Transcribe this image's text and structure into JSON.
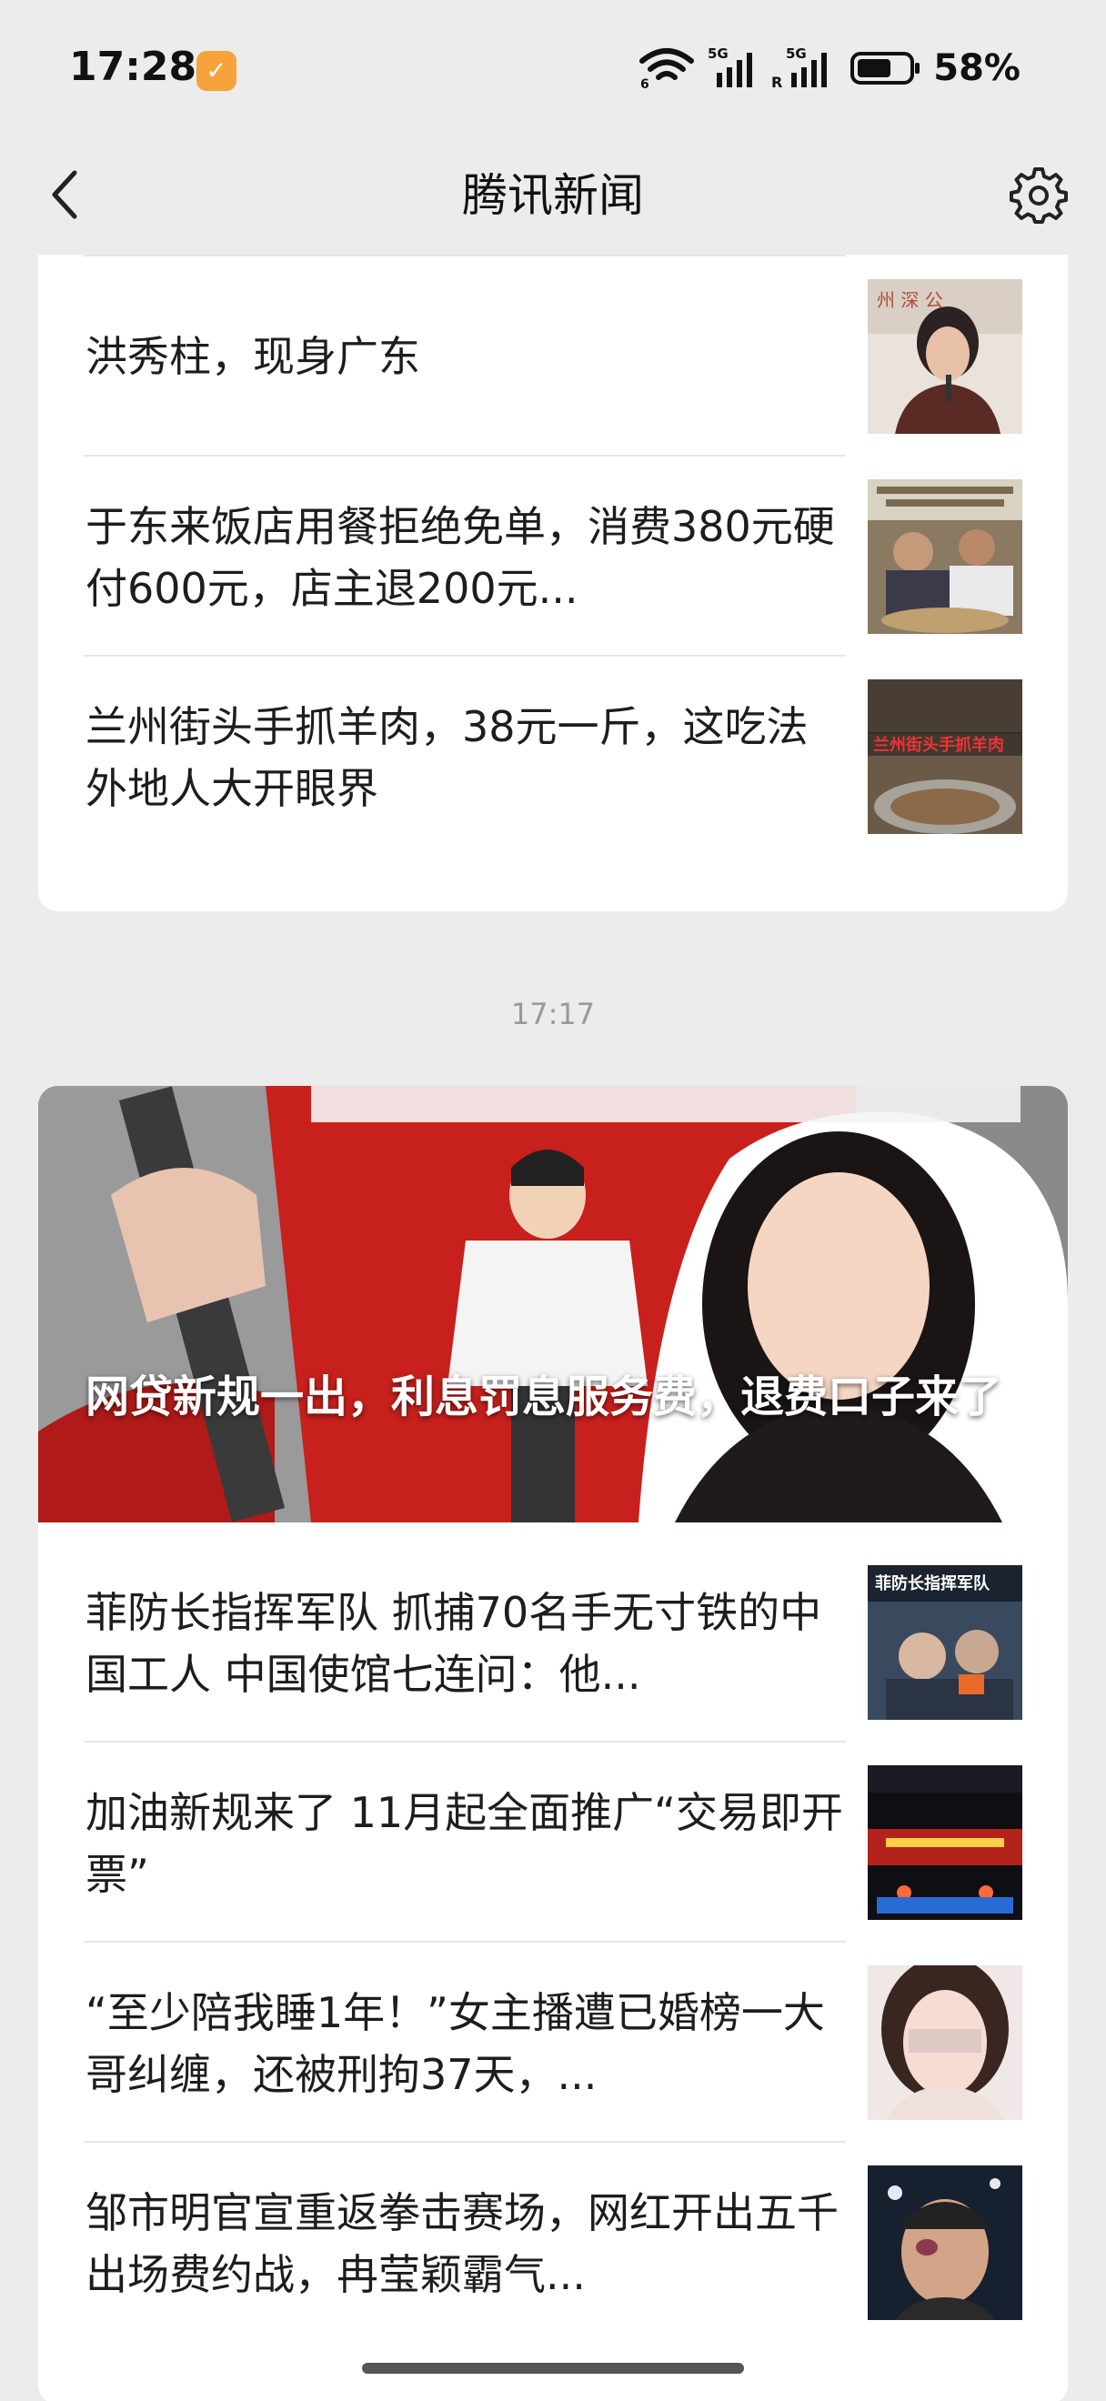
{
  "status_bar": {
    "time": "17:28",
    "battery": "58%",
    "signal1_label": "5G",
    "signal2_label": "5G",
    "wifi_sub": "6",
    "sim2_sub": "R"
  },
  "header": {
    "title": "腾讯新闻"
  },
  "card1": {
    "items": [
      {
        "title": "洪秀柱，现身广东"
      },
      {
        "title": "于东来饭店用餐拒绝免单，消费380元硬付600元，店主退200元..."
      },
      {
        "title": "兰州街头手抓羊肉，38元一斤，这吃法外地人大开眼界"
      }
    ]
  },
  "time_separator": "17:17",
  "card2": {
    "hero": {
      "title": "网贷新规一出，利息罚息服务费，退费口子来了"
    },
    "items": [
      {
        "title": "菲防长指挥军队 抓捕70名手无寸铁的中国工人 中国使馆七连问：他..."
      },
      {
        "title": "加油新规来了 11月起全面推广“交易即开票”"
      },
      {
        "title": "“至少陪我睡1年！”女主播遭已婚榜一大哥纠缠，还被刑拘37天，..."
      },
      {
        "title": "邹市明官宣重返拳击赛场，网红开出五千出场费约战，冉莹颖霸气..."
      }
    ]
  },
  "colors": {
    "background": "#ececec",
    "card": "#ffffff",
    "app_icon": "#f7a23a"
  }
}
